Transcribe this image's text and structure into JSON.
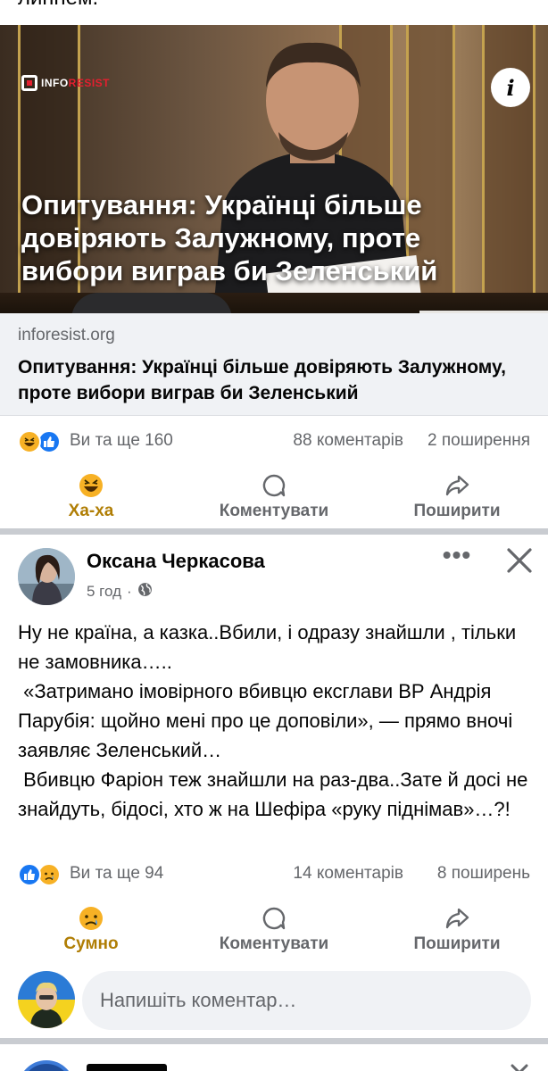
{
  "top_cut_text": "липнем.",
  "link_preview": {
    "image_logo": "INFORESIST",
    "image_logo_parts": [
      "INFO",
      "RESIST"
    ],
    "image_headline": "Опитування: Українці більше довіряють Залужному, проте вибори виграв би Зеленський",
    "info_button": "i",
    "domain": "inforesist.org",
    "title": "Опитування: Українці більше довіряють Залужному, проте вибори виграв би Зеленський"
  },
  "post1_stats": {
    "reactions": [
      "haha",
      "like"
    ],
    "reactions_text": "Ви та ще 160",
    "comments": "88 коментарів",
    "shares": "2 поширення"
  },
  "post1_actions": {
    "react": {
      "label": "Ха-ха",
      "icon": "haha-emoji-icon"
    },
    "comment": {
      "label": "Коментувати",
      "icon": "comment-icon"
    },
    "share": {
      "label": "Поширити",
      "icon": "share-icon"
    }
  },
  "post2": {
    "author": "Оксана Черкасова",
    "time": "5 год",
    "time_separator": "·",
    "privacy_icon": "globe-icon",
    "more_label": "•••",
    "text": "Ну не країна, а казка..Вбили, і одразу знайшли , тільки не замовника…..\n «Затримано імовірного вбивцю ексглави ВР Андрія Парубія: щойно мені про це доповіли», — прямо вночі заявляє Зеленський…\n Вбивцю Фаріон теж знайшли на раз-два..Зате й досі не знайдуть, бідосі, хто ж на Шефіра «руку піднімав»…?!"
  },
  "post2_stats": {
    "reactions": [
      "like",
      "sad"
    ],
    "reactions_text": "Ви та ще 94",
    "comments": "14 коментарів",
    "shares": "8 поширень"
  },
  "post2_actions": {
    "react": {
      "label": "Сумно",
      "icon": "sad-emoji-icon"
    },
    "comment": {
      "label": "Коментувати",
      "icon": "comment-icon"
    },
    "share": {
      "label": "Поширити",
      "icon": "share-icon"
    }
  },
  "comment_box": {
    "placeholder": "Напишіть коментар…"
  },
  "colors": {
    "meta_bg": "#f0f2f5",
    "secondary_text": "#65676b",
    "reaction_active": "#b07e05",
    "like_blue": "#1877f2",
    "separator": "#c9ccd1"
  }
}
